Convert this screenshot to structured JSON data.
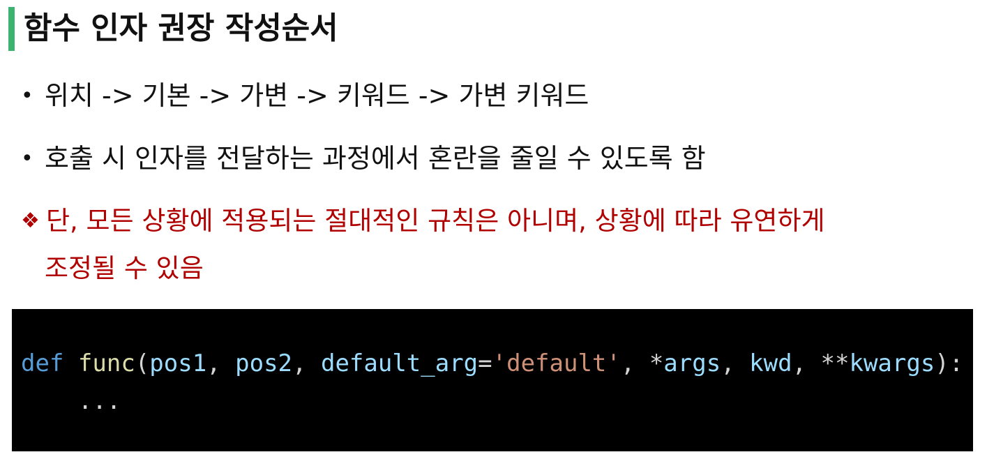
{
  "heading": {
    "title": "함수 인자 권장 작성순서",
    "accent_color": "#3cb371"
  },
  "bullets": [
    {
      "marker": "•",
      "text": "위치 -> 기본 -> 가변 -> 키워드 -> 가변 키워드"
    },
    {
      "marker": "•",
      "text": "호출 시 인자를 전달하는 과정에서 혼란을 줄일 수 있도록 함"
    }
  ],
  "note": {
    "marker": "❖",
    "line1": "단, 모든 상황에 적용되는 절대적인 규칙은 아니며, 상황에 따라 유연하게",
    "line2": "조정될 수 있음",
    "color": "#b00000"
  },
  "code": {
    "background": "#000000",
    "line1": {
      "keyword": "def",
      "func_name": "func",
      "open_paren": "(",
      "p1": "pos1",
      "c1": ", ",
      "p2": "pos2",
      "c2": ", ",
      "p3": "default_arg",
      "eq": "=",
      "p3_value": "'default'",
      "c3": ", ",
      "star1": "*",
      "p4": "args",
      "c4": ", ",
      "p5": "kwd",
      "c5": ", ",
      "star2": "**",
      "p6": "kwargs",
      "close": "):"
    },
    "line2": "    ..."
  }
}
